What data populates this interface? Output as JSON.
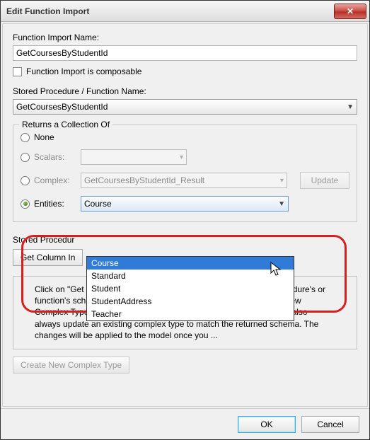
{
  "titlebar": {
    "title": "Edit Function Import"
  },
  "form": {
    "name_label": "Function Import Name:",
    "name_value": "GetCoursesByStudentId",
    "composable_label": "Function Import is composable",
    "sp_label": "Stored Procedure / Function Name:",
    "sp_value": "GetCoursesByStudentId"
  },
  "returns": {
    "legend": "Returns a Collection Of",
    "none": "None",
    "scalars": "Scalars:",
    "complex": "Complex:",
    "complex_value": "GetCoursesByStudentId_Result",
    "update": "Update",
    "entities": "Entities:",
    "entities_value": "Course",
    "options": [
      "Course",
      "Standard",
      "Student",
      "StudentAddress",
      "Teacher"
    ]
  },
  "sp_info": {
    "label_cut": "Stored Procedur",
    "get_cols_cut": "Get Column In",
    "info_text": "Click on \"Get Column Information\" above to retrieve the stored procedure's or function's schema. Once the schema is available, click on \"Create New Complex Type\" below to create a compatible complex type. You can also always update an existing complex type to match the returned schema. The changes will be applied to the model once you ...",
    "create_complex": "Create New Complex Type"
  },
  "footer": {
    "ok": "OK",
    "cancel": "Cancel"
  }
}
